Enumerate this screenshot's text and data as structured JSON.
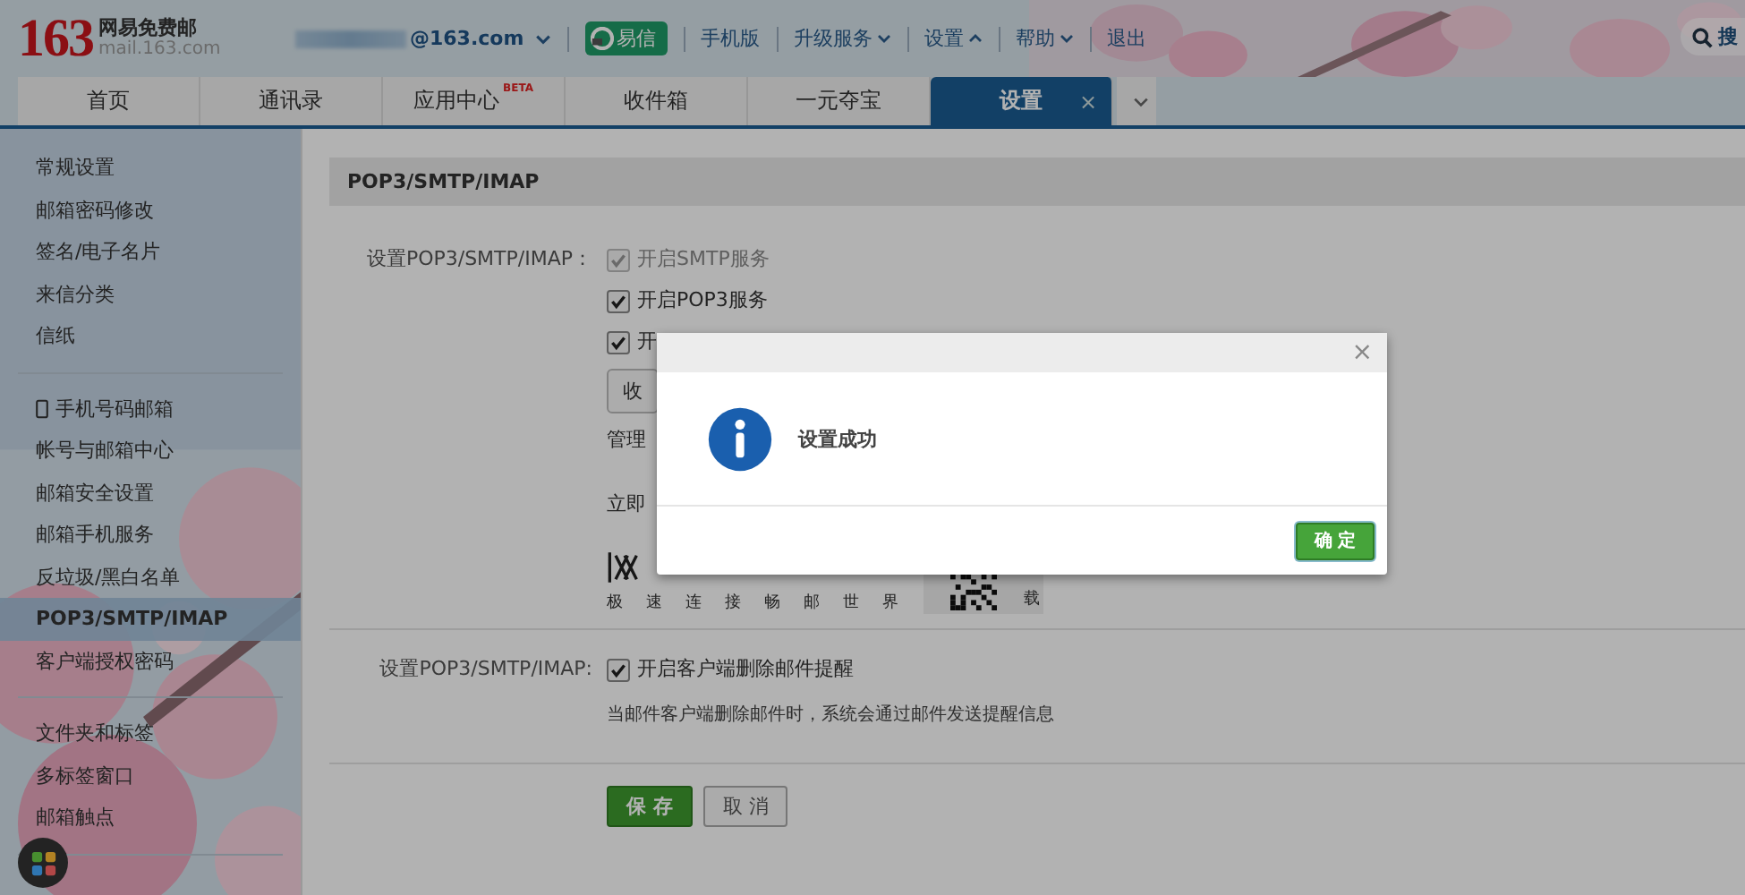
{
  "header": {
    "logo_number": "163",
    "logo_name": "网易免费邮",
    "logo_domain": "mail.163.com",
    "account_domain": "@163.com",
    "yixin": "易信",
    "links": [
      {
        "label": "手机版",
        "dropdown": false
      },
      {
        "label": "升级服务",
        "dropdown": true,
        "expanded": false
      },
      {
        "label": "设置",
        "dropdown": true,
        "expanded": true
      },
      {
        "label": "帮助",
        "dropdown": true,
        "expanded": false
      },
      {
        "label": "退出",
        "dropdown": false
      }
    ],
    "search": "搜"
  },
  "tabs": [
    {
      "label": "首页",
      "selected": false
    },
    {
      "label": "通讯录",
      "selected": false
    },
    {
      "label": "应用中心",
      "badge": "BETA",
      "selected": false
    },
    {
      "label": "收件箱",
      "selected": false
    },
    {
      "label": "一元夺宝",
      "selected": false
    },
    {
      "label": "设置",
      "close": "×",
      "selected": true
    }
  ],
  "sidebar": {
    "groups": [
      [
        {
          "label": "常规设置",
          "kind": "plain",
          "selected": false
        },
        {
          "label": "邮箱密码修改",
          "kind": "plain",
          "selected": false
        },
        {
          "label": "签名/电子名片",
          "kind": "plain",
          "selected": false
        },
        {
          "label": "来信分类",
          "kind": "plain",
          "selected": false
        },
        {
          "label": "信纸",
          "kind": "plain",
          "selected": false
        }
      ],
      [
        {
          "label": "手机号码邮箱",
          "kind": "phone",
          "selected": false
        },
        {
          "label": "帐号与邮箱中心",
          "kind": "plain",
          "selected": false
        },
        {
          "label": "邮箱安全设置",
          "kind": "plain",
          "selected": false
        },
        {
          "label": "邮箱手机服务",
          "kind": "plain",
          "selected": false
        },
        {
          "label": "反垃圾/黑白名单",
          "kind": "plain",
          "selected": false
        },
        {
          "label": "POP3/SMTP/IMAP",
          "kind": "plain",
          "selected": true
        },
        {
          "label": "客户端授权密码",
          "kind": "plain",
          "selected": false
        }
      ],
      [
        {
          "label": "文件夹和标签",
          "kind": "plain",
          "selected": false
        },
        {
          "label": "多标签窗口",
          "kind": "plain",
          "selected": false
        },
        {
          "label": "邮箱触点",
          "kind": "plain",
          "selected": false
        }
      ]
    ]
  },
  "content": {
    "section_title": "POP3/SMTP/IMAP",
    "service_label": "设置POP3/SMTP/IMAP：",
    "services": [
      {
        "label": "开启SMTP服务",
        "checked": true,
        "disabled": true
      },
      {
        "label": "开启POP3服务",
        "checked": true,
        "disabled": false
      },
      {
        "label": "开",
        "checked": true,
        "disabled": false
      }
    ],
    "receive_button": "收",
    "manage_text": "管理",
    "download_text": "立即",
    "banner": {
      "slogan": [
        "极",
        "速",
        "连",
        "接",
        "畅",
        "邮",
        "世",
        "界"
      ],
      "side": "载"
    },
    "reminder_label": "设置POP3/SMTP/IMAP:",
    "reminder": {
      "label": "开启客户端删除邮件提醒",
      "checked": true
    },
    "reminder_note": "当邮件客户端删除邮件时，系统会通过邮件发送提醒信息",
    "buttons": [
      {
        "label": "保 存",
        "kind": "primary"
      },
      {
        "label": "取 消",
        "kind": "secondary"
      }
    ]
  },
  "dialog": {
    "close": "×",
    "message": "设置成功",
    "ok": "确 定"
  }
}
